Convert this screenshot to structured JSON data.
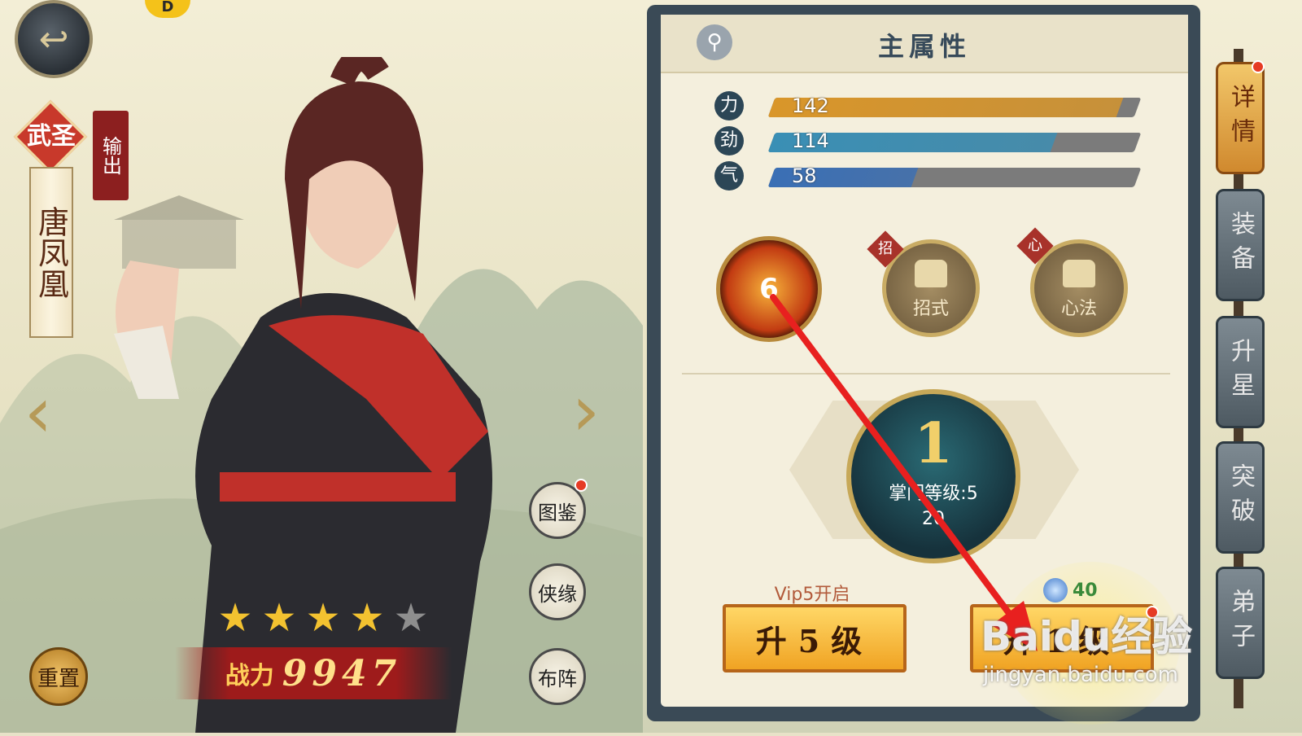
{
  "hero": {
    "rank": "武圣",
    "role": "输出",
    "name": "唐凤凰",
    "stars_filled": 4,
    "stars_total": 5,
    "power_label": "战力",
    "power_value": "9947"
  },
  "left_buttons": {
    "reset": "重置",
    "codex": "图鉴",
    "bond": "侠缘",
    "formation": "布阵"
  },
  "panel": {
    "title": "主属性",
    "stats": [
      {
        "icon": "力",
        "value": "142",
        "fill": 0.95,
        "color": "#d9962a"
      },
      {
        "icon": "劲",
        "value": "114",
        "fill": 0.77,
        "color": "#3a8fb5"
      },
      {
        "icon": "气",
        "value": "58",
        "fill": 0.39,
        "color": "#3a6fb5"
      }
    ],
    "skills": {
      "main_level": "6",
      "slot2_tag": "招",
      "slot2_label": "招式",
      "slot3_tag": "心",
      "slot3_label": "心法"
    },
    "level": {
      "number": "1",
      "label": "掌门等级:5",
      "count": "20"
    },
    "vip_tag": "Vip5开启",
    "btn_up5": "升5级",
    "btn_up1": "升1级",
    "cost": "40"
  },
  "side_tabs": [
    "详情",
    "装备",
    "升星",
    "突破",
    "弟子"
  ],
  "watermark": {
    "text": "Baidu经验",
    "url": "jingyan.baidu.com"
  },
  "colors": {
    "panel_frame": "#3a4a56",
    "gold": "#f0a323",
    "annotation_arrow": "#e8201f"
  }
}
